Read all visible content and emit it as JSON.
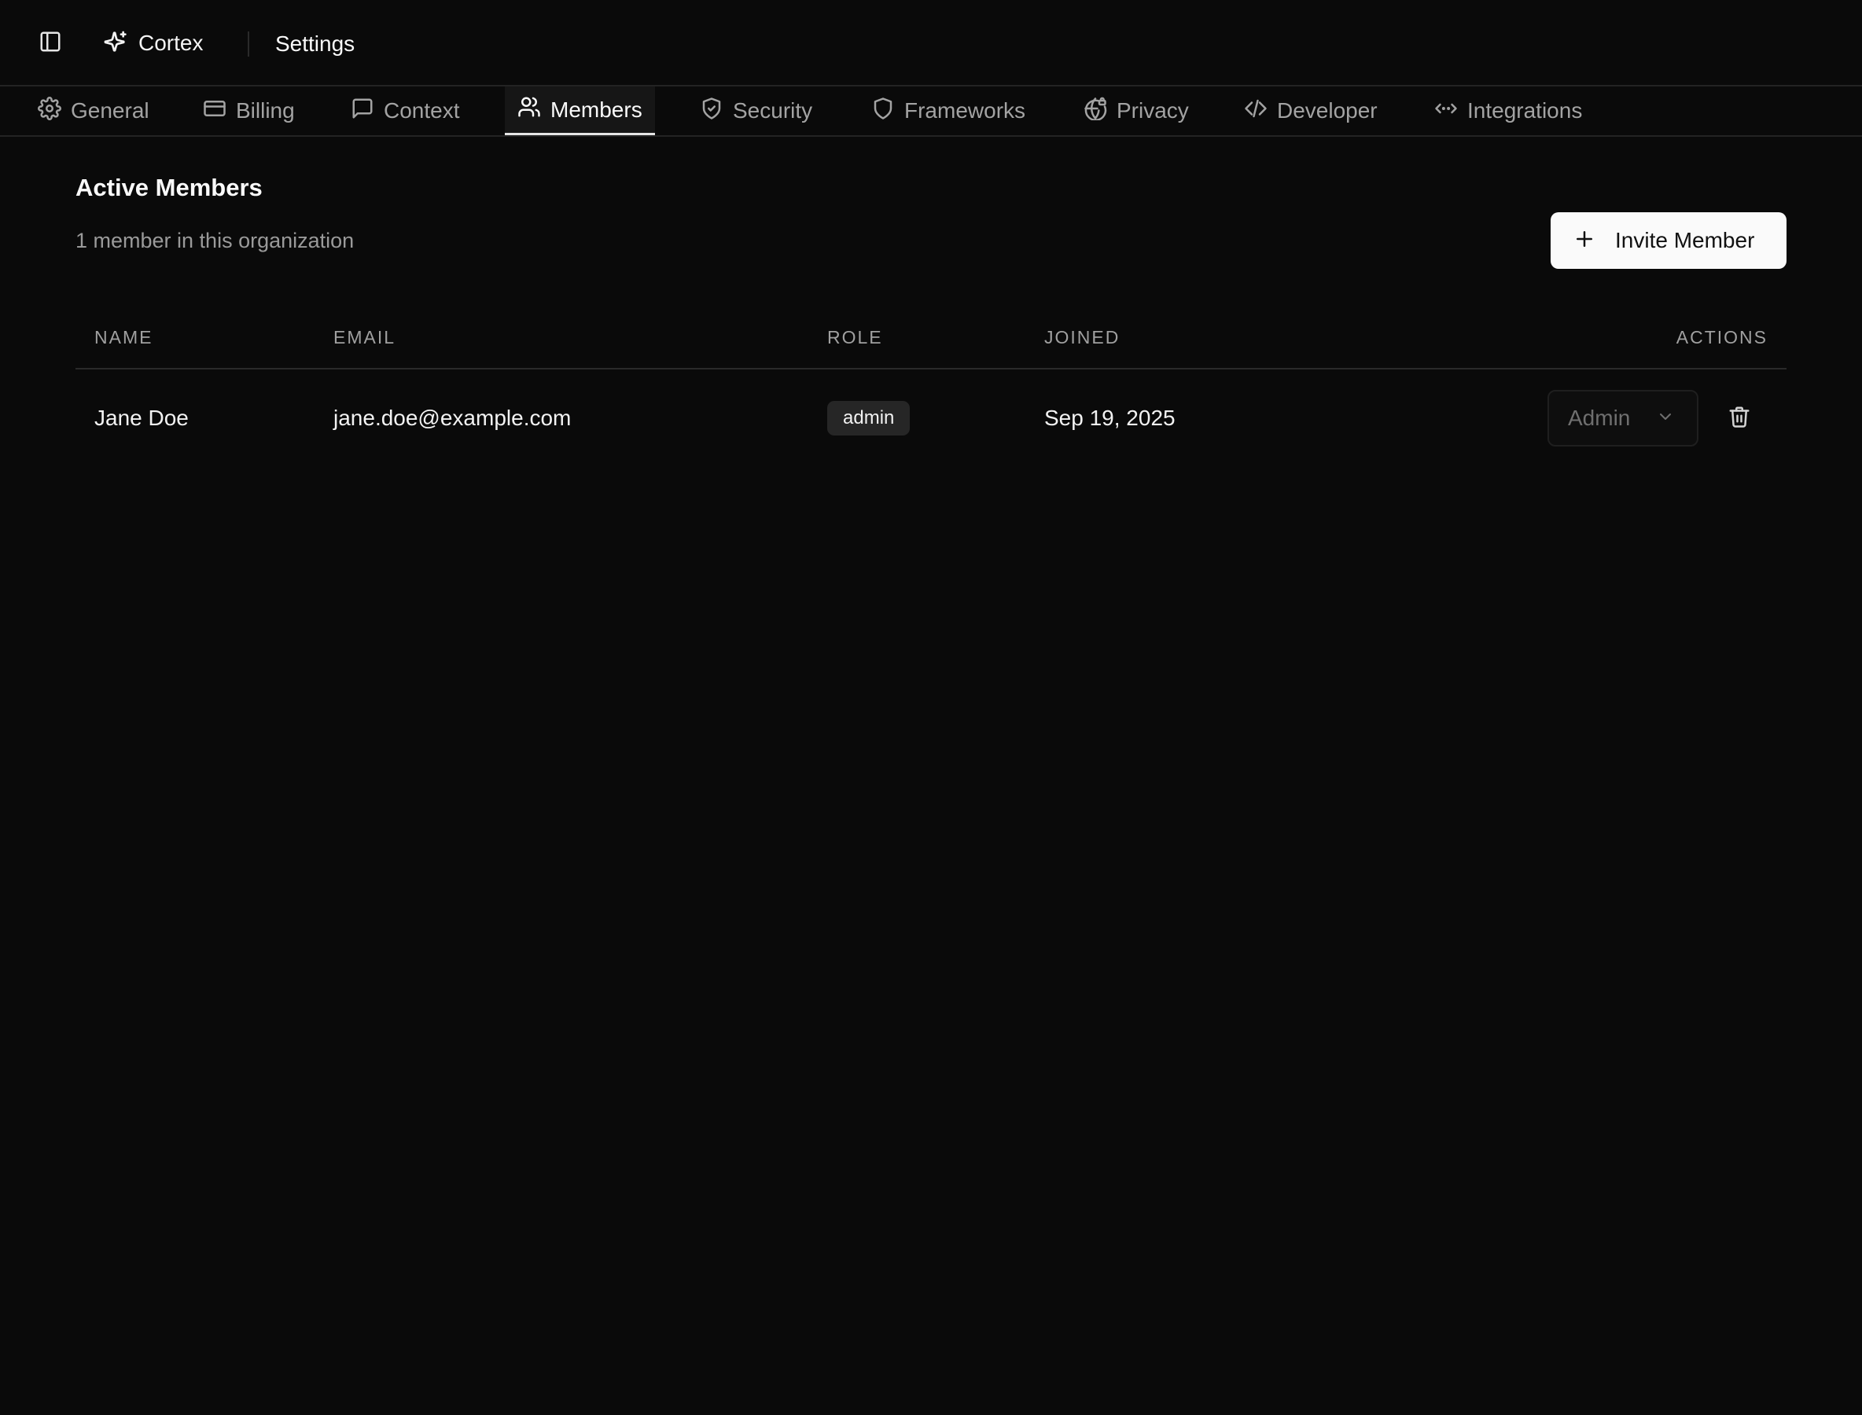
{
  "app": {
    "name": "Cortex",
    "page_title": "Settings"
  },
  "tabs": [
    {
      "label": "General",
      "icon": "gear-icon",
      "active": false
    },
    {
      "label": "Billing",
      "icon": "credit-card-icon",
      "active": false
    },
    {
      "label": "Context",
      "icon": "message-square-icon",
      "active": false
    },
    {
      "label": "Members",
      "icon": "users-icon",
      "active": true
    },
    {
      "label": "Security",
      "icon": "shield-check-icon",
      "active": false
    },
    {
      "label": "Frameworks",
      "icon": "shield-icon",
      "active": false
    },
    {
      "label": "Privacy",
      "icon": "globe-lock-icon",
      "active": false
    },
    {
      "label": "Developer",
      "icon": "code-icon",
      "active": false
    },
    {
      "label": "Integrations",
      "icon": "code-xml-icon",
      "active": false
    }
  ],
  "members": {
    "title": "Active Members",
    "subtitle": "1 member in this organization",
    "invite_label": "Invite Member",
    "columns": [
      "NAME",
      "EMAIL",
      "ROLE",
      "JOINED",
      "ACTIONS"
    ],
    "rows": [
      {
        "name": "Jane Doe",
        "email": "jane.doe@example.com",
        "role_badge": "admin",
        "joined": "Sep 19, 2025",
        "role_select": "Admin"
      }
    ]
  },
  "colors": {
    "background": "#0a0a0a",
    "border": "#232323",
    "text_primary": "#fafafa",
    "text_muted": "#a3a3a3",
    "button_bg": "#fafafa",
    "badge_bg": "#262626"
  }
}
